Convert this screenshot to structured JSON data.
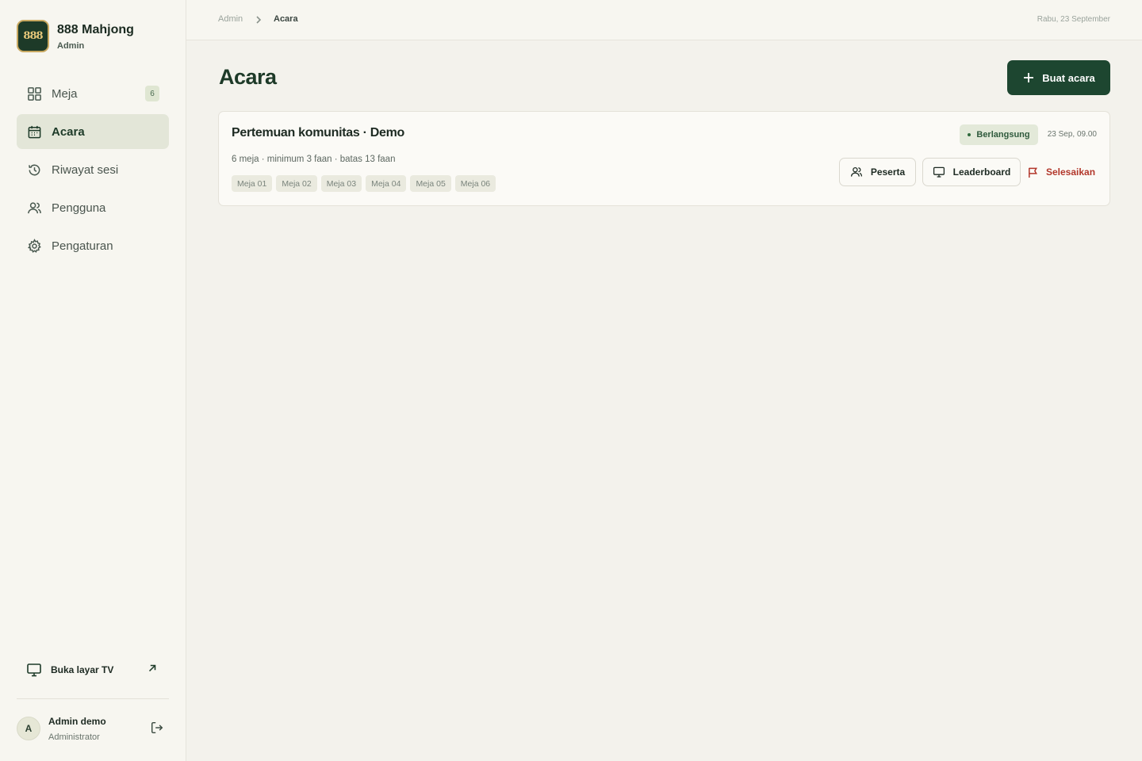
{
  "brand": {
    "logo_text": "888",
    "title": "888 Mahjong",
    "subtitle": "Admin"
  },
  "sidebar": {
    "items": [
      {
        "label": "Meja",
        "icon": "grid-icon",
        "badge": "6",
        "active": false
      },
      {
        "label": "Acara",
        "icon": "calendar-icon",
        "active": true
      },
      {
        "label": "Riwayat sesi",
        "icon": "history-icon",
        "active": false
      },
      {
        "label": "Pengguna",
        "icon": "users-icon",
        "active": false
      },
      {
        "label": "Pengaturan",
        "icon": "gear-icon",
        "active": false
      }
    ],
    "tv_link": "Buka layar TV",
    "user": {
      "initial": "A",
      "name": "Admin demo",
      "role": "Administrator"
    }
  },
  "breadcrumb": {
    "root": "Admin",
    "current": "Acara"
  },
  "header": {
    "date": "Rabu, 23 September"
  },
  "main": {
    "title": "Acara",
    "create_button": "Buat acara",
    "events": [
      {
        "title": "Pertemuan komunitas · Demo",
        "meta": "6 meja · minimum 3 faan · batas 13 faan",
        "tables": [
          "Meja 01",
          "Meja 02",
          "Meja 03",
          "Meja 04",
          "Meja 05",
          "Meja 06"
        ],
        "status": "Berlangsung",
        "datetime": "23 Sep, 09.00",
        "actions": {
          "participants": "Peserta",
          "leaderboard": "Leaderboard",
          "finish": "Selesaikan"
        }
      }
    ]
  },
  "colors": {
    "accent": "#1d4630",
    "danger": "#b2372b",
    "status_bg": "#e3e9d9",
    "background": "#f3f2ec"
  }
}
